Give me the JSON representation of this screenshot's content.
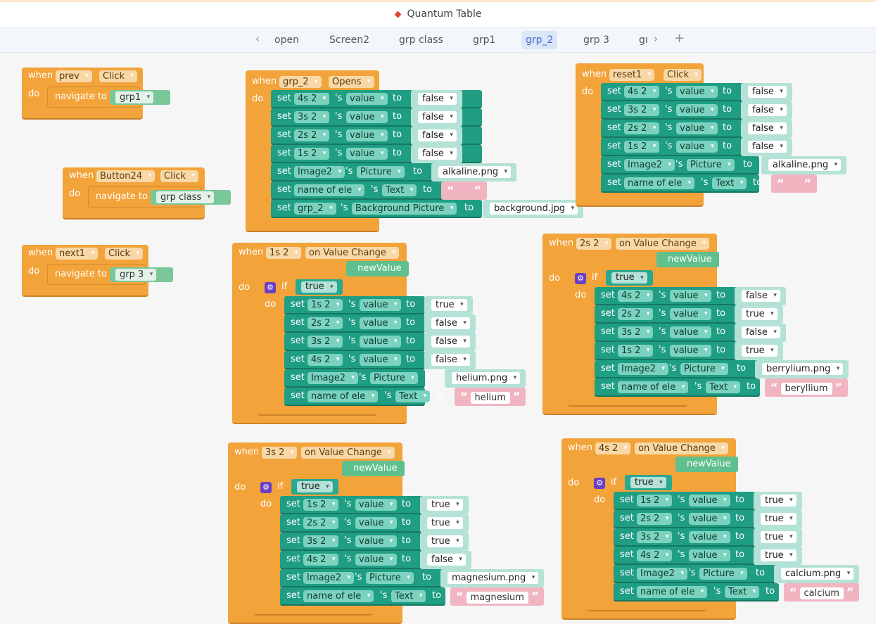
{
  "app": {
    "title": "Quantum Table",
    "logo_icon": "ruby-logo-icon"
  },
  "tabs": [
    {
      "label": "open"
    },
    {
      "label": "Screen2"
    },
    {
      "label": "grp class"
    },
    {
      "label": "grp1"
    },
    {
      "label": "grp_2",
      "active": true
    },
    {
      "label": "grp 3"
    },
    {
      "label": "gı"
    }
  ],
  "nav_icons": {
    "prev": "chevron-left-icon",
    "next": "chevron-right-icon",
    "add": "plus-icon"
  },
  "keywords": {
    "when": "when",
    "do": "do",
    "navigate_to": "navigate to",
    "set": "set",
    "s": "'s",
    "to": "to",
    "if": "if",
    "true": "true",
    "false": "false",
    "new_value": "newValue"
  },
  "blocks": {
    "prev": {
      "component": "prev",
      "event": "Click",
      "target": "grp1"
    },
    "button24": {
      "component": "Button24",
      "event": "Click",
      "target": "grp class"
    },
    "next1": {
      "component": "next1",
      "event": "Click",
      "target": "grp 3"
    },
    "opens": {
      "component": "grp_2",
      "event": "Opens",
      "rows": [
        {
          "comp": "4s 2",
          "prop": "value",
          "val": "false"
        },
        {
          "comp": "3s 2",
          "prop": "value",
          "val": "false"
        },
        {
          "comp": "2s 2",
          "prop": "value",
          "val": "false"
        },
        {
          "comp": "1s 2",
          "prop": "value",
          "val": "false"
        },
        {
          "comp": "Image2",
          "prop": "Picture",
          "val": "alkaline.png"
        },
        {
          "comp": "name of ele",
          "prop": "Text",
          "val": ""
        },
        {
          "comp": "grp_2",
          "prop": "Background Picture",
          "val": "background.jpg"
        }
      ]
    },
    "reset1": {
      "component": "reset1",
      "event": "Click",
      "rows": [
        {
          "comp": "4s 2",
          "prop": "value",
          "val": "false"
        },
        {
          "comp": "3s 2",
          "prop": "value",
          "val": "false"
        },
        {
          "comp": "2s 2",
          "prop": "value",
          "val": "false"
        },
        {
          "comp": "1s 2",
          "prop": "value",
          "val": "false"
        },
        {
          "comp": "Image2",
          "prop": "Picture",
          "val": "alkaline.png"
        },
        {
          "comp": "name of ele",
          "prop": "Text",
          "val": ""
        }
      ]
    },
    "s1": {
      "component": "1s 2",
      "event": "on Value Change",
      "rows": [
        {
          "comp": "1s 2",
          "prop": "value",
          "val": "true"
        },
        {
          "comp": "2s 2",
          "prop": "value",
          "val": "false"
        },
        {
          "comp": "3s 2",
          "prop": "value",
          "val": "false"
        },
        {
          "comp": "4s 2",
          "prop": "value",
          "val": "false"
        },
        {
          "comp": "Image2",
          "prop": "Picture",
          "val": "helium.png"
        },
        {
          "comp": "name of ele",
          "prop": "Text",
          "val": "helium"
        }
      ]
    },
    "s2": {
      "component": "2s 2",
      "event": "on Value Change",
      "rows": [
        {
          "comp": "4s 2",
          "prop": "value",
          "val": "false"
        },
        {
          "comp": "2s 2",
          "prop": "value",
          "val": "true"
        },
        {
          "comp": "3s 2",
          "prop": "value",
          "val": "false"
        },
        {
          "comp": "1s 2",
          "prop": "value",
          "val": "true"
        },
        {
          "comp": "Image2",
          "prop": "Picture",
          "val": "berrylium.png"
        },
        {
          "comp": "name of ele",
          "prop": "Text",
          "val": "beryllium"
        }
      ]
    },
    "s3": {
      "component": "3s 2",
      "event": "on Value Change",
      "rows": [
        {
          "comp": "1s 2",
          "prop": "value",
          "val": "true"
        },
        {
          "comp": "2s 2",
          "prop": "value",
          "val": "true"
        },
        {
          "comp": "3s 2",
          "prop": "value",
          "val": "true"
        },
        {
          "comp": "4s 2",
          "prop": "value",
          "val": "false"
        },
        {
          "comp": "Image2",
          "prop": "Picture",
          "val": "magnesium.png"
        },
        {
          "comp": "name of ele",
          "prop": "Text",
          "val": "magnesium"
        }
      ]
    },
    "s4": {
      "component": "4s 2",
      "event": "on Value Change",
      "rows": [
        {
          "comp": "1s 2",
          "prop": "value",
          "val": "true"
        },
        {
          "comp": "2s 2",
          "prop": "value",
          "val": "true"
        },
        {
          "comp": "3s 2",
          "prop": "value",
          "val": "true"
        },
        {
          "comp": "4s 2",
          "prop": "value",
          "val": "true"
        },
        {
          "comp": "Image2",
          "prop": "Picture",
          "val": "calcium.png"
        },
        {
          "comp": "name of ele",
          "prop": "Text",
          "val": "calcium"
        }
      ]
    }
  }
}
